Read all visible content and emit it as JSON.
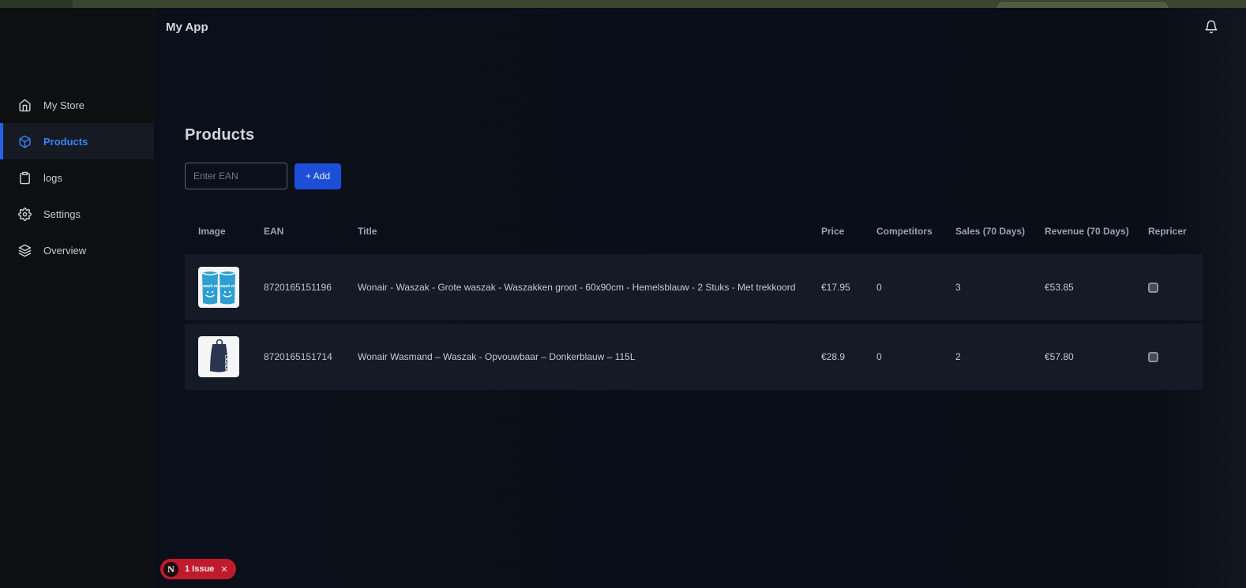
{
  "topbar": {
    "title": "My App"
  },
  "sidebar": {
    "items": [
      {
        "label": "My Store"
      },
      {
        "label": "Products"
      },
      {
        "label": "logs"
      },
      {
        "label": "Settings"
      },
      {
        "label": "Overview"
      }
    ]
  },
  "page": {
    "title": "Products",
    "ean_input": {
      "placeholder": "Enter EAN",
      "value": ""
    },
    "add_button_label": "+ Add"
  },
  "table": {
    "columns": [
      "Image",
      "EAN",
      "Title",
      "Price",
      "Competitors",
      "Sales (70 Days)",
      "Revenue (70 Days)",
      "Repricer"
    ],
    "rows": [
      {
        "image_alt": "two blue wash bags with smiley faces",
        "ean": "8720165151196",
        "title": "Wonair - Waszak - Grote waszak - Waszakken groot - 60x90cm - Hemelsblauw - 2 Stuks - Met trekkoord",
        "price": "€17.95",
        "competitors": "0",
        "sales": "3",
        "revenue": "€53.85",
        "repricer_checked": false
      },
      {
        "image_alt": "dark blue foldable laundry bag",
        "ean": "8720165151714",
        "title": "Wonair Wasmand – Waszak - Opvouwbaar – Donkerblauw – 115L",
        "price": "€28.9",
        "competitors": "0",
        "sales": "2",
        "revenue": "€57.80",
        "repricer_checked": false
      }
    ]
  },
  "dev_badge": {
    "logo": "N",
    "label": "1 Issue",
    "close": "✕"
  },
  "colors": {
    "accent_blue": "#2563eb",
    "active_link_blue": "#3d82f6",
    "add_button_blue": "#1d4ed8",
    "row_background": "#141a26",
    "main_background": "#0a0f19",
    "sidebar_background": "#0e0f11",
    "badge_red": "#bf1b2c",
    "browser_strip_green": "#39452f"
  }
}
